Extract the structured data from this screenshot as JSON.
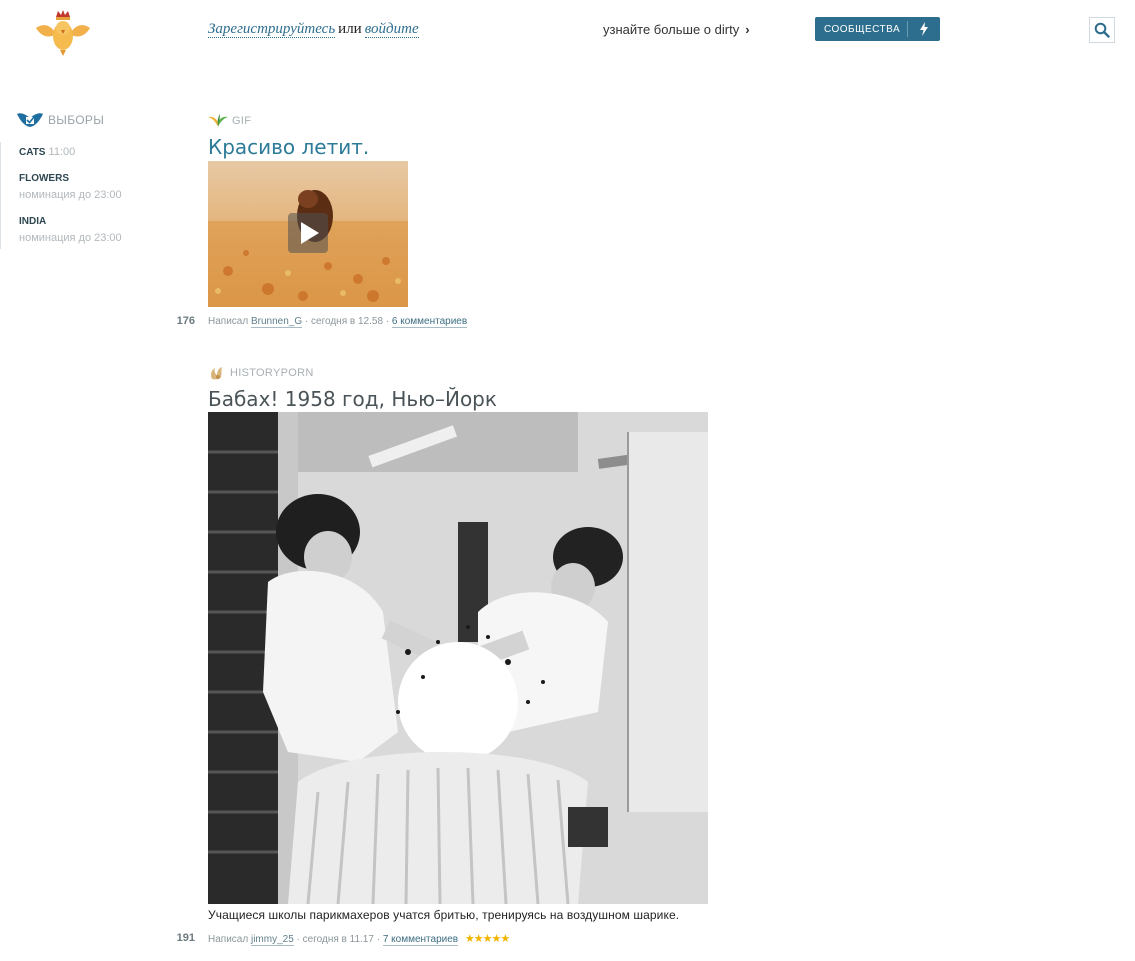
{
  "header": {
    "register_label": "Зарегистрируйтесь",
    "or_label": "или",
    "login_label": "войдите",
    "learn_more_label": "узнайте больше о dirty",
    "communities_label": "СООБЩЕСТВА"
  },
  "sidebar": {
    "title": "ВЫБОРЫ",
    "items": [
      {
        "name": "CATS",
        "time": "11:00",
        "sub": ""
      },
      {
        "name": "FLOWERS",
        "time": "",
        "sub": "номинация до 23:00"
      },
      {
        "name": "INDIA",
        "time": "",
        "sub": "номинация до 23:00"
      }
    ]
  },
  "posts": [
    {
      "category": "GIF",
      "title": "Красиво летит.",
      "rating": "176",
      "written_by_label": "Написал",
      "author": "Brunnen_G",
      "date": "· сегодня в 12.58 ·",
      "comments": "6 комментариев"
    },
    {
      "category": "HISTORYPORN",
      "title": "Бабах! 1958 год, Нью–Йорк",
      "caption": "Учащиеся школы парикмахеров учатся бритью, тренируясь на воздушном шарике.",
      "rating": "191",
      "written_by_label": "Написал",
      "author": "jimmy_25",
      "date": "· сегодня в 11.17 ·",
      "comments": "7 комментариев",
      "stars": "★★★★★"
    }
  ],
  "colors": {
    "accent": "#2d6e8e",
    "link": "#2d7b98",
    "star": "#f1b400"
  }
}
